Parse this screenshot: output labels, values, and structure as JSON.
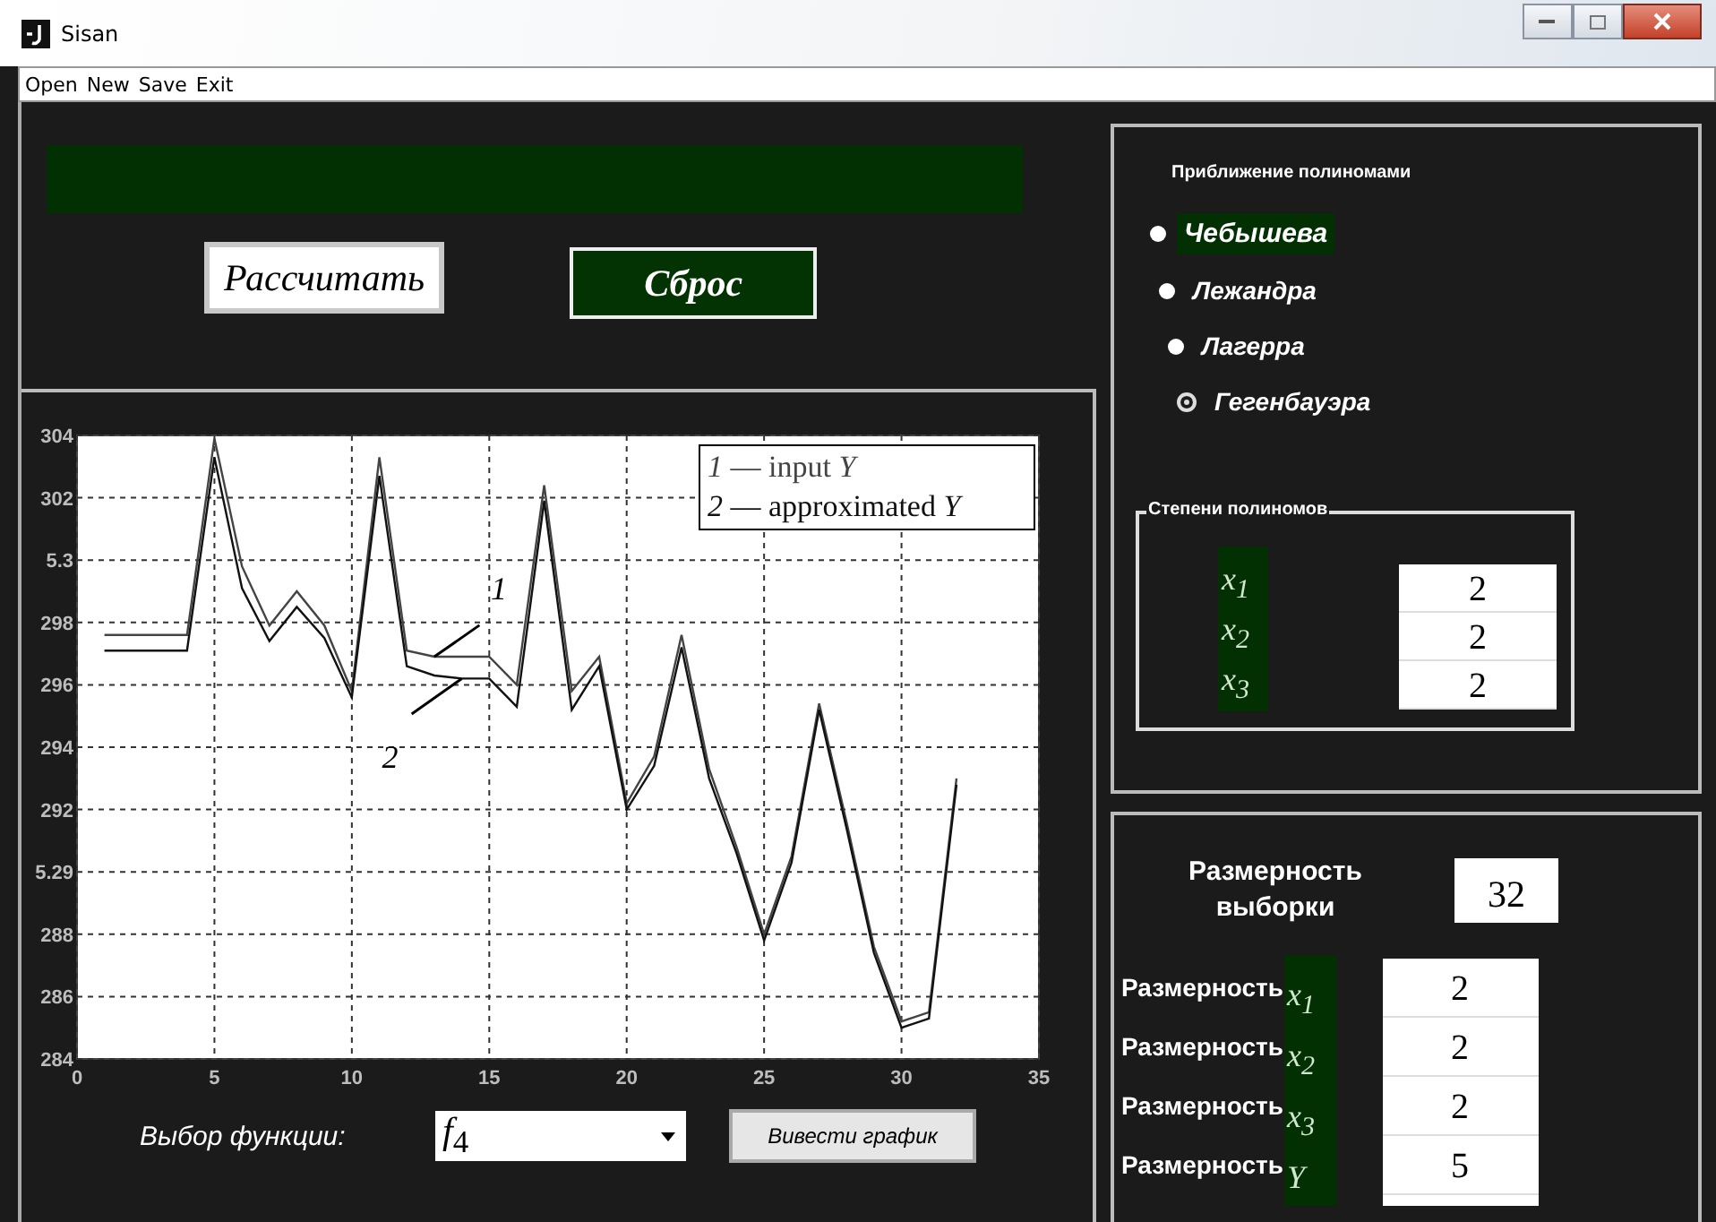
{
  "window": {
    "title": "Sisan"
  },
  "menu": [
    "Open",
    "New",
    "Save",
    "Exit"
  ],
  "actions": {
    "buttons": [
      {
        "label": "Рассчитать",
        "kind": "plain"
      },
      {
        "label": "Сброс",
        "kind": "accent"
      }
    ]
  },
  "chart_panel": {
    "chart_data": {
      "type": "line",
      "x": [
        1,
        2,
        3,
        4,
        5,
        6,
        7,
        8,
        9,
        10,
        11,
        12,
        13,
        14,
        15,
        16,
        17,
        18,
        19,
        20,
        21,
        22,
        23,
        24,
        25,
        26,
        27,
        28,
        29,
        30,
        31,
        32
      ],
      "series": [
        {
          "name": "*1* — input *Y*",
          "color": "#444444",
          "values": [
            297.6,
            297.6,
            297.6,
            297.6,
            303.9,
            299.8,
            297.9,
            299.0,
            297.9,
            295.8,
            303.3,
            297.1,
            296.9,
            296.9,
            296.9,
            296.0,
            302.4,
            295.8,
            296.9,
            292.2,
            293.7,
            297.6,
            293.3,
            290.8,
            288.0,
            290.5,
            295.4,
            291.6,
            287.6,
            285.2,
            285.5,
            293.0
          ]
        },
        {
          "name": "*2* — approximated *Y*",
          "color": "#111111",
          "values": [
            297.1,
            297.1,
            297.1,
            297.1,
            303.3,
            299.1,
            297.4,
            298.5,
            297.5,
            295.6,
            302.7,
            296.6,
            296.3,
            296.2,
            296.2,
            295.3,
            301.9,
            295.2,
            296.6,
            292.0,
            293.4,
            297.2,
            293.0,
            290.6,
            287.8,
            290.3,
            295.2,
            291.4,
            287.4,
            285.0,
            285.3,
            292.8
          ]
        }
      ],
      "xlim": [
        0,
        35
      ],
      "ylim": [
        284,
        304
      ],
      "xticks": [
        0,
        5,
        10,
        15,
        20,
        25,
        30,
        35
      ],
      "yticks": [
        284,
        286,
        288,
        292,
        294,
        296,
        298,
        302,
        304
      ],
      "grid": true,
      "annotations": [
        {
          "text": "1",
          "x": 13,
          "y": 296.9
        },
        {
          "text": "2",
          "x": 14,
          "y": 296.2
        }
      ]
    },
    "misprinted_y_labels": [
      "5.3",
      "5.29"
    ],
    "function_label": "Выбор функции:",
    "function_select": {
      "value": "*f*$_{4}$"
    },
    "plot_button": "Вивести график"
  },
  "approximation": {
    "title": "Приближение полиномами",
    "options": [
      {
        "label": "Чебышева",
        "selected": false,
        "highlighted": true
      },
      {
        "label": "Лежандра",
        "selected": false,
        "highlighted": false
      },
      {
        "label": "Лагерра",
        "selected": false,
        "highlighted": false
      },
      {
        "label": "Гегенбауэра",
        "selected": true,
        "highlighted": false
      }
    ],
    "degrees": {
      "title": "Степени полиномов",
      "rows": [
        {
          "variable": "x$_{1}$",
          "value": "2"
        },
        {
          "variable": "x$_{2}$",
          "value": "2"
        },
        {
          "variable": "x$_{3}$",
          "value": "2"
        }
      ]
    }
  },
  "dimensions": {
    "sample_label": "Размерность выборки",
    "sample_value": "32",
    "rows": [
      {
        "label": "Размерность",
        "variable": "x$_{1}$",
        "value": "2"
      },
      {
        "label": "Размерность",
        "variable": "x$_{2}$",
        "value": "2"
      },
      {
        "label": "Размерность",
        "variable": "x$_{3}$",
        "value": "2"
      },
      {
        "label": "Размерность",
        "variable": "Y",
        "value": "5"
      }
    ]
  }
}
